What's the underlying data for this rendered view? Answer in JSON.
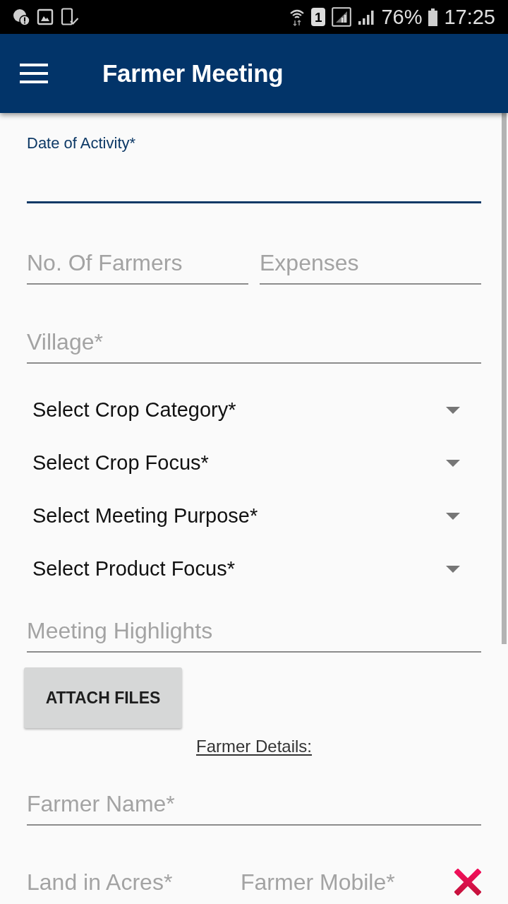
{
  "status_bar": {
    "sim_slot": "1",
    "battery_text": "76%",
    "time": "17:25"
  },
  "app_bar": {
    "title": "Farmer Meeting"
  },
  "date_field": {
    "label": "Date of Activity*",
    "focused": true
  },
  "count_fields": [
    {
      "placeholder": "No. Of Farmers"
    },
    {
      "placeholder": "Expenses"
    }
  ],
  "village_field": {
    "placeholder": "Village*"
  },
  "dropdowns": [
    {
      "label": "Select Crop Category*"
    },
    {
      "label": "Select Crop Focus*"
    },
    {
      "label": "Select Meeting Purpose*"
    },
    {
      "label": "Select Product Focus*"
    }
  ],
  "highlights_field": {
    "placeholder": "Meeting Highlights"
  },
  "attach_button": {
    "label": "ATTACH FILES"
  },
  "farmer_section": {
    "title": "Farmer Details:",
    "name_field": {
      "placeholder": "Farmer Name*"
    },
    "row_fields": [
      {
        "placeholder": "Land in Acres*"
      },
      {
        "placeholder": "Farmer Mobile*"
      }
    ]
  }
}
